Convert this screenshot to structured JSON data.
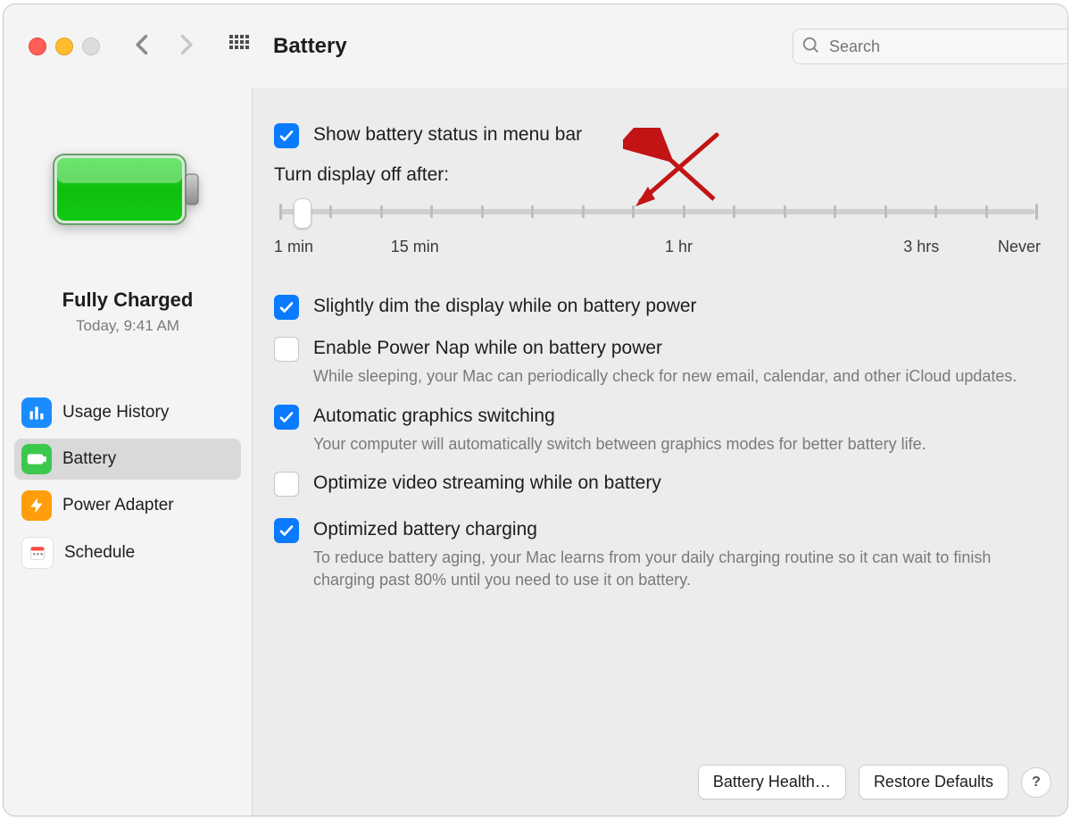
{
  "toolbar": {
    "title": "Battery",
    "search_placeholder": "Search"
  },
  "sidebar": {
    "status_title": "Fully Charged",
    "status_sub": "Today, 9:41 AM",
    "items": [
      {
        "id": "usage-history",
        "label": "Usage History"
      },
      {
        "id": "battery",
        "label": "Battery"
      },
      {
        "id": "power-adapter",
        "label": "Power Adapter"
      },
      {
        "id": "schedule",
        "label": "Schedule"
      }
    ],
    "selected": "battery"
  },
  "main": {
    "show_status_label": "Show battery status in menu bar",
    "show_status_checked": true,
    "slider": {
      "title": "Turn display off after:",
      "labels": [
        "1 min",
        "15 min",
        "1 hr",
        "3 hrs",
        "Never"
      ],
      "ticks": 16,
      "knob_percent": 3
    },
    "options": [
      {
        "id": "dim",
        "label": "Slightly dim the display while on battery power",
        "checked": true,
        "desc": ""
      },
      {
        "id": "powernap",
        "label": "Enable Power Nap while on battery power",
        "checked": false,
        "desc": "While sleeping, your Mac can periodically check for new email, calendar, and other iCloud updates."
      },
      {
        "id": "gpu",
        "label": "Automatic graphics switching",
        "checked": true,
        "desc": "Your computer will automatically switch between graphics modes for better battery life."
      },
      {
        "id": "videostream",
        "label": "Optimize video streaming while on battery",
        "checked": false,
        "desc": ""
      },
      {
        "id": "optcharge",
        "label": "Optimized battery charging",
        "checked": true,
        "desc": "To reduce battery aging, your Mac learns from your daily charging routine so it can wait to finish charging past 80% until you need to use it on battery."
      }
    ]
  },
  "footer": {
    "health": "Battery Health…",
    "restore": "Restore Defaults",
    "help": "?"
  },
  "colors": {
    "accent": "#0a7aff"
  }
}
